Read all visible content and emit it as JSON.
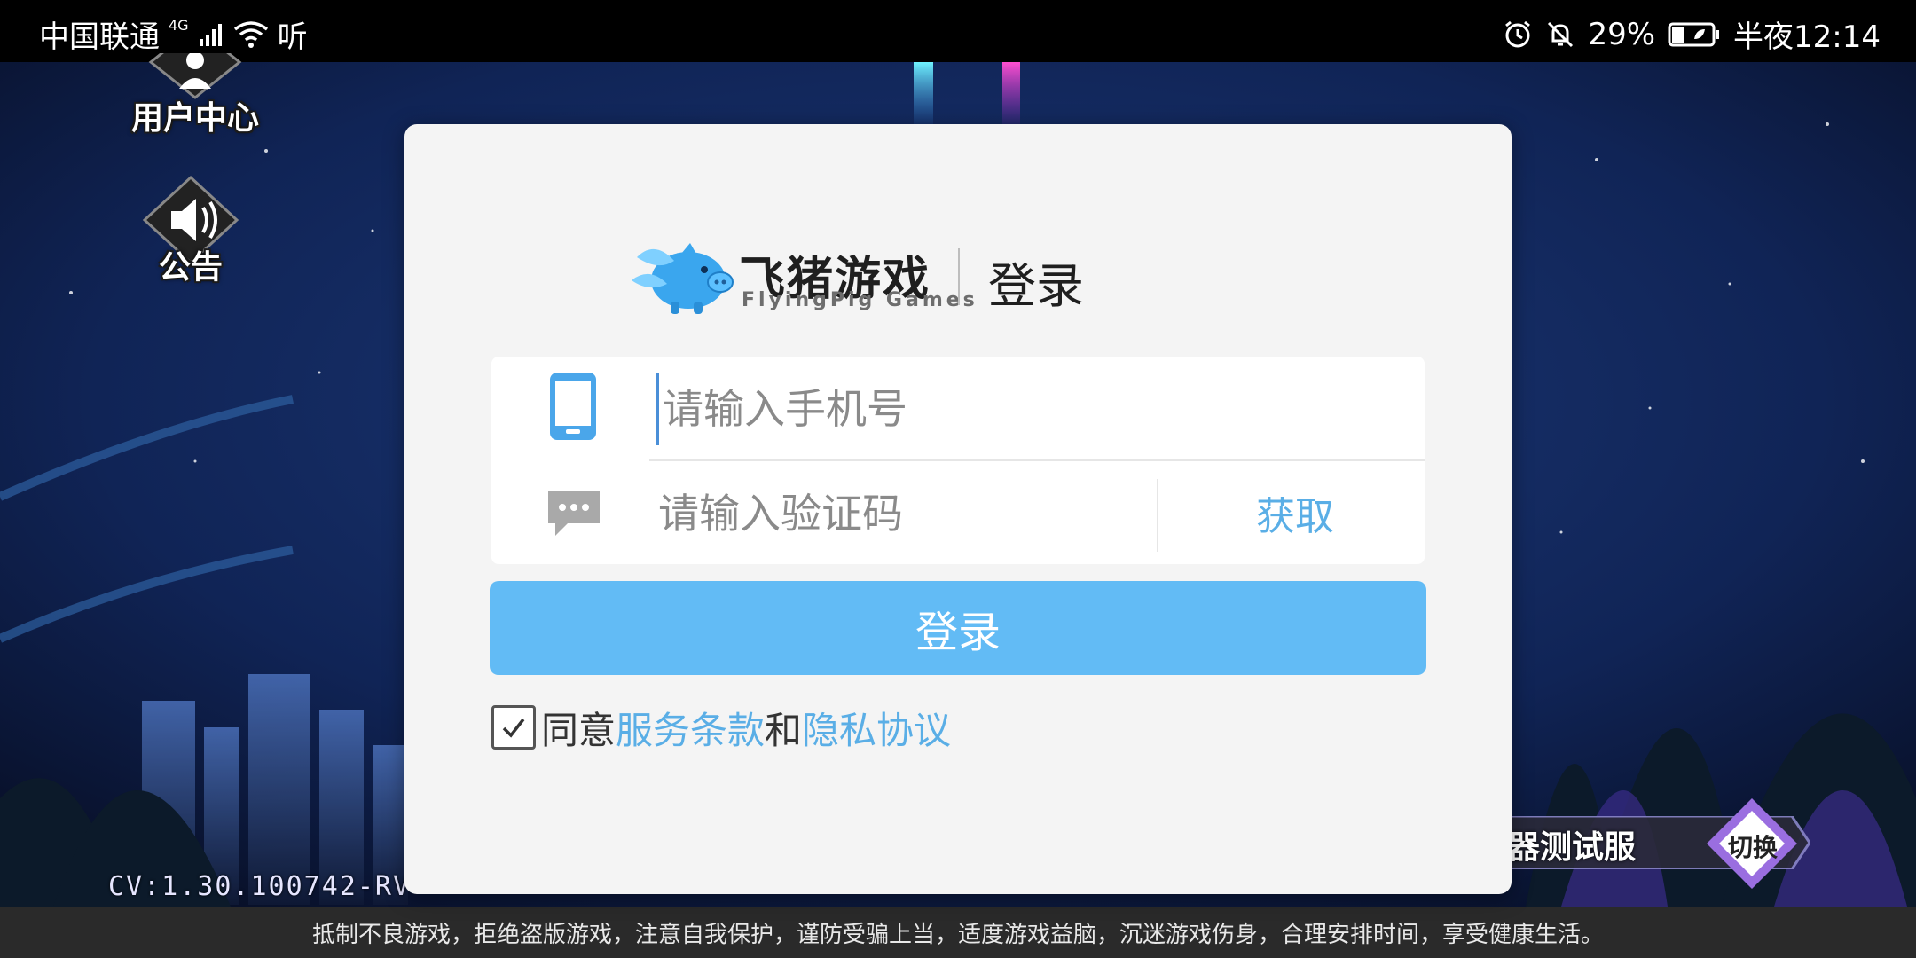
{
  "status_bar": {
    "carrier": "中国联通",
    "network": "4G",
    "extra": "听",
    "battery": "29%",
    "time": "半夜12:14"
  },
  "side_menu": {
    "user_center": "用户中心",
    "announcement": "公告"
  },
  "dialog": {
    "brand_cn": "飞猪游戏",
    "brand_en": "FlyingPig Games",
    "title": "登录",
    "phone_placeholder": "请输入手机号",
    "code_placeholder": "请输入验证码",
    "get_code": "获取",
    "login_button": "登录",
    "agree_prefix": "同意",
    "terms_link": "服务条款",
    "agree_and": "和",
    "privacy_link": "隐私协议"
  },
  "game": {
    "version": "CV:1.30.100742-RV",
    "server_name": "器测试服",
    "switch_label": "切换",
    "health_notice": "抵制不良游戏，拒绝盗版游戏，注意自我保护，谨防受骗上当，适度游戏益脑，沉迷游戏伤身，合理安排时间，享受健康生活。"
  },
  "colors": {
    "accent": "#62bbf5",
    "link": "#5aaee6",
    "dialog_bg": "#f4f4f4"
  }
}
